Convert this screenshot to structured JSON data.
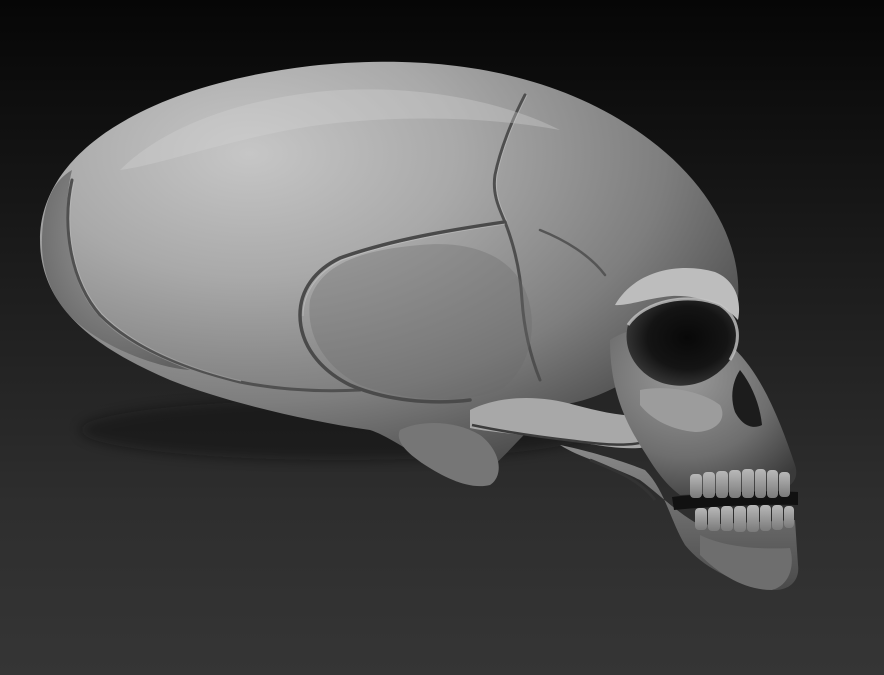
{
  "scene": {
    "subject_icon": "skull-icon",
    "background_top": "#060606",
    "background_bottom": "#353535",
    "material_highlight": "#c4c4c4",
    "material_mid": "#8e8e8e",
    "material_shadow": "#2e2e2e",
    "teeth": {
      "upper_count": 8,
      "lower_count": 8
    }
  }
}
